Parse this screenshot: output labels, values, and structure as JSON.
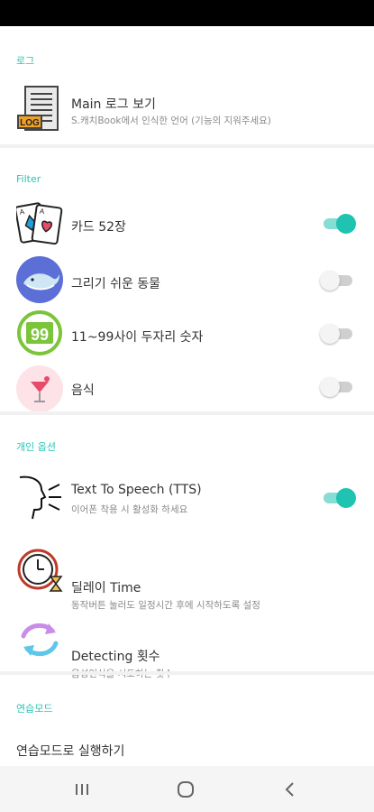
{
  "sections": {
    "log": "로그",
    "filter": "Filter",
    "personal": "개인 옵션",
    "practice": "연습모드"
  },
  "log_item": {
    "title": "Main 로그 보기",
    "subtitle": "S.캐치Book에서 인식한 언어 (기능의 지워주세요)",
    "icon_text": "LOG"
  },
  "filters": [
    {
      "label": "카드 52장",
      "icon": "playing-cards-icon",
      "enabled": true
    },
    {
      "label": "그리기 쉬운 동물",
      "icon": "whale-icon",
      "enabled": false
    },
    {
      "label": "11~99사이 두자리 숫자",
      "icon": "number-99-icon",
      "enabled": false
    },
    {
      "label": "음식",
      "icon": "cocktail-icon",
      "enabled": false
    }
  ],
  "number_icon_text": "99",
  "options": [
    {
      "title": "Text To Speech (TTS)",
      "subtitle": "이어폰 착용 시 활성화 하세요",
      "icon": "speaking-head-icon",
      "toggle": true,
      "enabled": true
    },
    {
      "title": "딜레이 Time",
      "subtitle": "동작버튼 눌러도 일정시간 후에 시작하도록 설정",
      "icon": "clock-hourglass-icon",
      "toggle": false
    },
    {
      "title": "Detecting 횟수",
      "subtitle": "음성인식을 시도하는 횟수",
      "icon": "refresh-arrows-icon",
      "toggle": false
    }
  ],
  "practice_item": {
    "title": "연습모드로 실행하기"
  },
  "colors": {
    "accent": "#1ec3b2",
    "section_header": "#2bc4b6",
    "log_icon_badge": "#f0a024",
    "whale_bg": "#5b6fd6",
    "number_green": "#7cc43a",
    "food_bg": "#fde3e8",
    "toggle_off_track": "#cfcfcf"
  }
}
